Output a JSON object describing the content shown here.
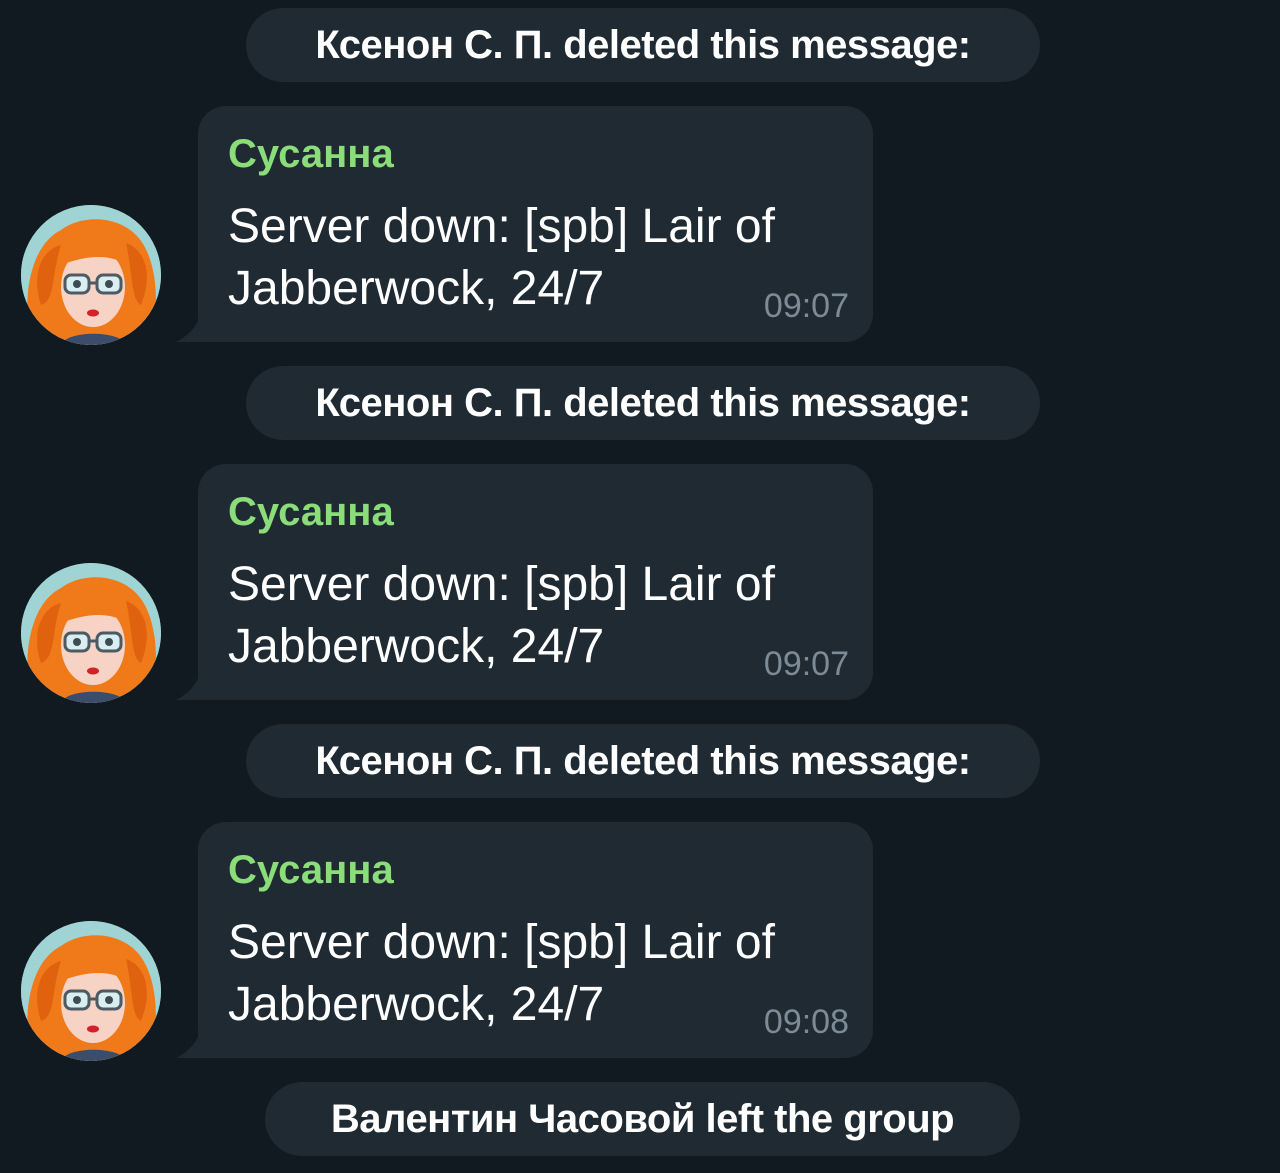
{
  "events": [
    {
      "type": "service",
      "text": "Ксенон С. П. deleted this message:"
    },
    {
      "type": "message",
      "sender": "Сусанна",
      "text": "Server down: [spb] Lair of\nJabberwock, 24/7",
      "time": "09:07",
      "avatar_icon": "woman-redhead-glasses-avatar"
    },
    {
      "type": "service",
      "text": "Ксенон С. П. deleted this message:"
    },
    {
      "type": "message",
      "sender": "Сусанна",
      "text": "Server down: [spb] Lair of\nJabberwock, 24/7",
      "time": "09:07",
      "avatar_icon": "woman-redhead-glasses-avatar"
    },
    {
      "type": "service",
      "text": "Ксенон С. П. deleted this message:"
    },
    {
      "type": "message",
      "sender": "Сусанна",
      "text": "Server down: [spb] Lair of\nJabberwock, 24/7",
      "time": "09:08",
      "avatar_icon": "woman-redhead-glasses-avatar"
    },
    {
      "type": "service",
      "text": "Валентин Часовой left the group"
    }
  ],
  "colors": {
    "background": "#111a21",
    "bubble": "#1f2a33",
    "sender_name": "#8bdd7a",
    "timestamp": "#7d8b96",
    "text": "#ffffff"
  }
}
